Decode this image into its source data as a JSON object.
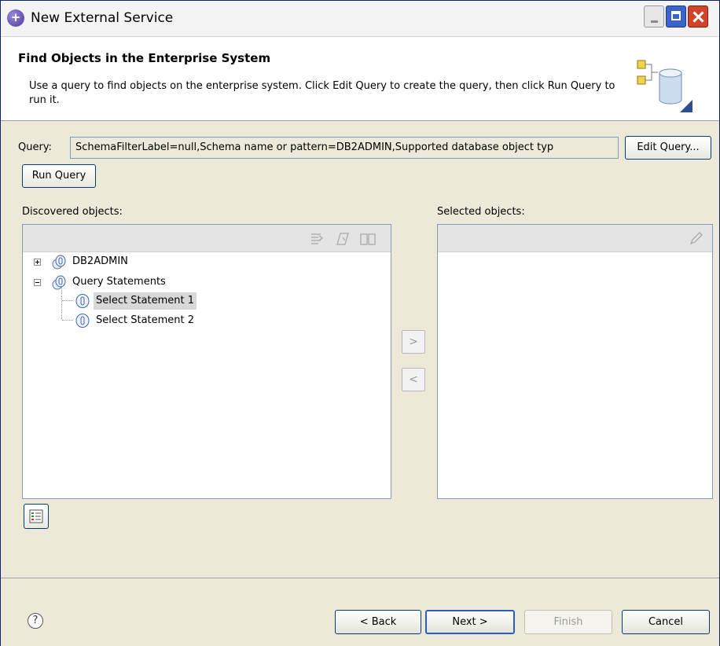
{
  "window": {
    "title": "New External Service"
  },
  "banner": {
    "title": "Find Objects in the Enterprise System",
    "description": "Use a query to find objects on the enterprise system.  Click Edit Query to create the query, then click Run Query to run it."
  },
  "query": {
    "label": "Query:",
    "value": "SchemaFilterLabel=null,Schema name or pattern=DB2ADMIN,Supported database object typ",
    "edit_button": "Edit Query...",
    "run_button": "Run Query"
  },
  "discovered": {
    "label": "Discovered objects:",
    "tree": [
      {
        "label": "DB2ADMIN",
        "expanded": false
      },
      {
        "label": "Query Statements",
        "expanded": true
      },
      {
        "label": "Select Statement 1",
        "selected": true
      },
      {
        "label": "Select Statement 2",
        "selected": false
      }
    ],
    "toolbar_icons": [
      "filter-icon",
      "edit-icon",
      "book-icon"
    ]
  },
  "selected": {
    "label": "Selected objects:",
    "toolbar_icons": [
      "pencil-icon"
    ]
  },
  "move": {
    "add_symbol": ">",
    "remove_symbol": "<"
  },
  "footer": {
    "help_symbol": "?",
    "back": "< Back",
    "next": "Next >",
    "finish": "Finish",
    "cancel": "Cancel",
    "finish_disabled": true
  },
  "colors": {
    "frame_background": "#ece9d8",
    "button_border": "#003c74",
    "default_button_border": "#2a5cc8"
  }
}
